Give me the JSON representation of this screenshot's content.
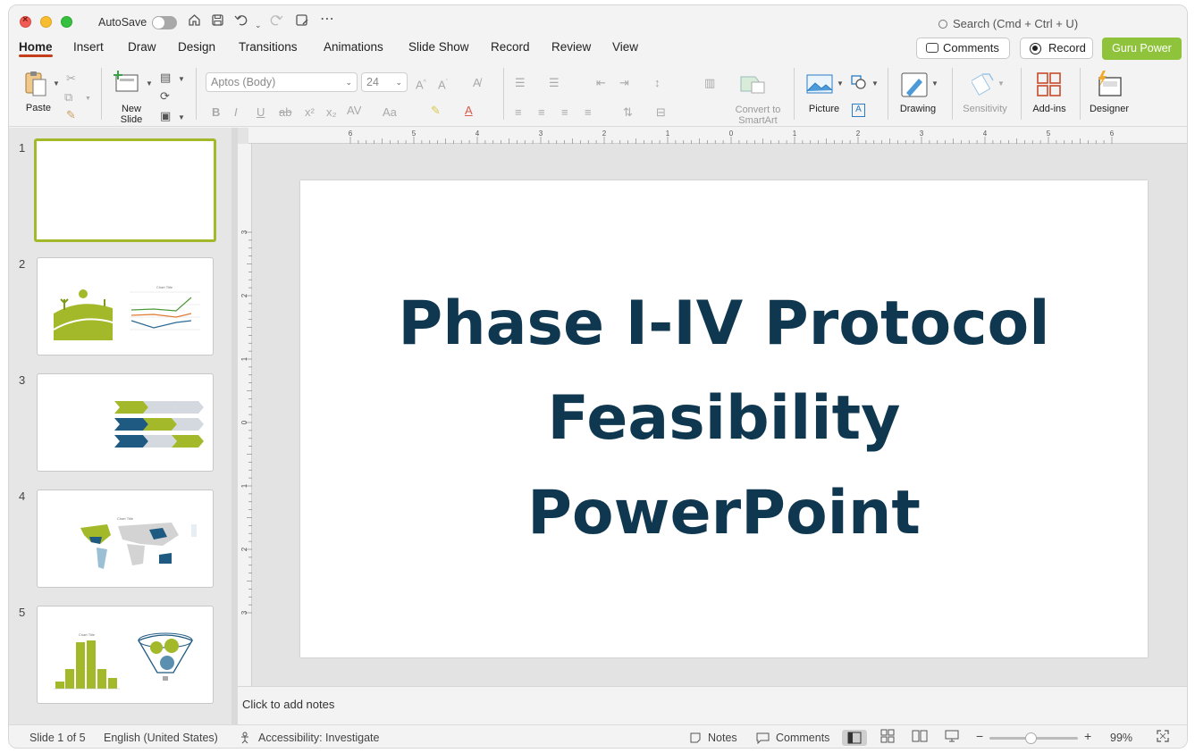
{
  "titlebar": {
    "autosave_label": "AutoSave",
    "search_placeholder": "Search (Cmd + Ctrl + U)"
  },
  "tabs": [
    "Home",
    "Insert",
    "Draw",
    "Design",
    "Transitions",
    "Animations",
    "Slide Show",
    "Record",
    "Review",
    "View"
  ],
  "active_tab": "Home",
  "header_buttons": {
    "comments": "Comments",
    "record": "Record",
    "guru": "Guru Power"
  },
  "ribbon": {
    "paste": "Paste",
    "new_slide_line1": "New",
    "new_slide_line2": "Slide",
    "font_name": "Aptos (Body)",
    "font_size": "24",
    "convert_line1": "Convert to",
    "convert_line2": "SmartArt",
    "picture": "Picture",
    "drawing": "Drawing",
    "sensitivity": "Sensitivity",
    "addins": "Add-ins",
    "designer": "Designer"
  },
  "slides": {
    "numbers": [
      "1",
      "2",
      "3",
      "4",
      "5"
    ],
    "selected": 1,
    "thumb2_chart_title": "Chart Title",
    "thumb4_chart_title": "Chart Title",
    "thumb5_chart_title": "Chart Title"
  },
  "slide": {
    "title_line1": "Phase I-IV Protocol",
    "title_line2": "Feasibility",
    "title_line3": "PowerPoint",
    "title_color": "#0f3850"
  },
  "notes": {
    "placeholder": "Click to add notes"
  },
  "statusbar": {
    "slide_pos": "Slide 1 of 5",
    "language": "English (United States)",
    "accessibility": "Accessibility: Investigate",
    "notes": "Notes",
    "comments": "Comments",
    "zoom": "99%"
  },
  "ruler": {
    "h_labels": [
      "6",
      "5",
      "4",
      "3",
      "2",
      "1",
      "0",
      "1",
      "2",
      "3",
      "4",
      "5",
      "6"
    ],
    "v_labels": [
      "3",
      "2",
      "1",
      "0",
      "1",
      "2",
      "3"
    ]
  },
  "colors": {
    "accent_green": "#8fc33b",
    "dark_blue": "#0f3850",
    "tab_underline": "#c43e1c"
  }
}
